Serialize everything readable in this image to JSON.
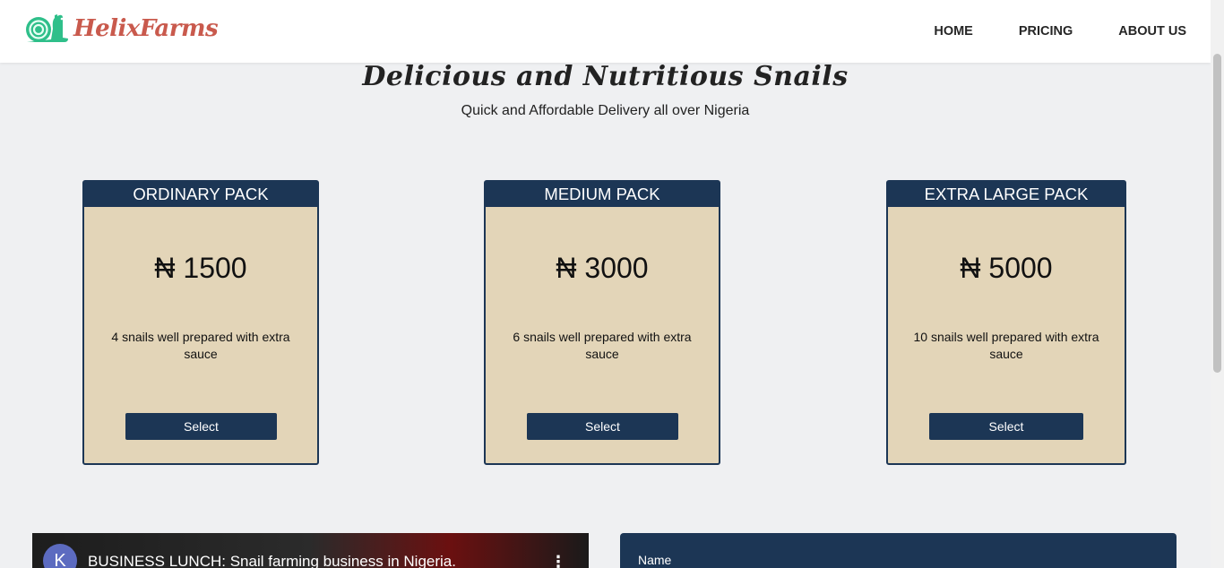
{
  "brand": {
    "name": "HelixFarms",
    "color": "#c95a4d",
    "icon": "snail-icon",
    "icon_color": "#2fbf8a"
  },
  "nav": {
    "items": [
      "HOME",
      "PRICING",
      "ABOUT US"
    ]
  },
  "hero": {
    "title": "Delicious and Nutritious Snails",
    "subtitle": "Quick and Affordable Delivery all over Nigeria"
  },
  "plans": [
    {
      "name": "ORDINARY PACK",
      "price": "₦ 1500",
      "description": "4 snails well prepared with extra sauce",
      "button": "Select"
    },
    {
      "name": "MEDIUM PACK",
      "price": "₦ 3000",
      "description": "6 snails well prepared with extra sauce",
      "button": "Select"
    },
    {
      "name": "EXTRA LARGE PACK",
      "price": "₦ 5000",
      "description": "10 snails well prepared with extra sauce",
      "button": "Select"
    }
  ],
  "video": {
    "channel_initial": "K",
    "title": "BUSINESS LUNCH: Snail farming business in Nigeria.",
    "menu_icon": "more-vert-icon"
  },
  "form": {
    "name_label": "Name"
  },
  "colors": {
    "navy": "#1c3655",
    "card_bg": "#e3d5b8",
    "page_bg": "#eff0f2"
  }
}
